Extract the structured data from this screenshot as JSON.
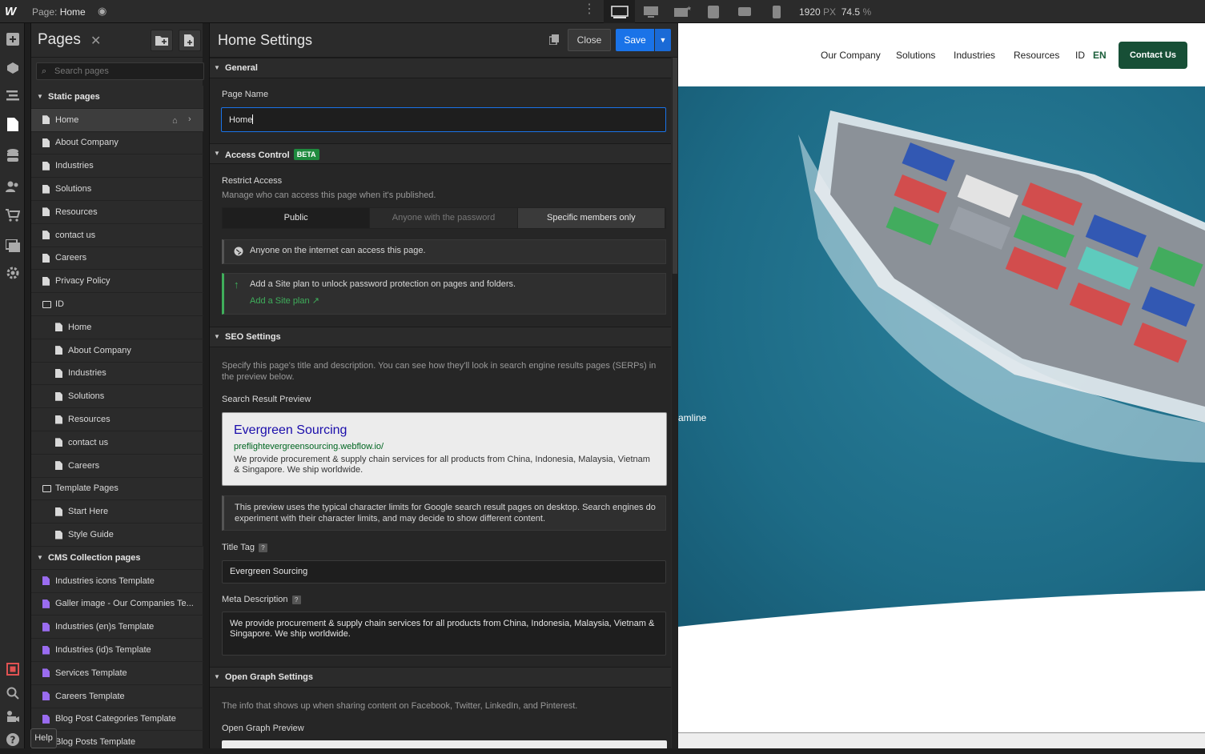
{
  "topbar": {
    "page_prefix": "Page:",
    "page_name": "Home",
    "width_value": "1920",
    "width_unit": "PX",
    "zoom_value": "74.5",
    "zoom_unit": "%"
  },
  "pages_panel": {
    "title": "Pages",
    "search_placeholder": "Search pages",
    "static_header": "Static pages",
    "static_pages": [
      "Home",
      "About Company",
      "Industries",
      "Solutions",
      "Resources",
      "contact us",
      "Careers",
      "Privacy Policy"
    ],
    "id_folder": "ID",
    "id_pages": [
      "Home",
      "About Company",
      "Industries",
      "Solutions",
      "Resources",
      "contact us",
      "Careers"
    ],
    "template_folder": "Template Pages",
    "template_pages": [
      "Start Here",
      "Style Guide"
    ],
    "cms_header": "CMS Collection pages",
    "cms_pages": [
      "Industries icons Template",
      "Galler image - Our Companies Te...",
      "Industries (en)s Template",
      "Industries (id)s Template",
      "Services Template",
      "Careers Template",
      "Blog Post Categories Template",
      "Blog Posts Template"
    ]
  },
  "settings": {
    "title": "Home Settings",
    "close_label": "Close",
    "save_label": "Save",
    "general": {
      "header": "General",
      "page_name_label": "Page Name",
      "page_name_value": "Home"
    },
    "access": {
      "header": "Access Control",
      "badge": "BETA",
      "restrict_label": "Restrict Access",
      "restrict_desc": "Manage who can access this page when it's published.",
      "options": [
        "Public",
        "Anyone with the password",
        "Specific members only"
      ],
      "public_note": "Anyone on the internet can access this page.",
      "upgrade_note": "Add a Site plan to unlock password protection on pages and folders.",
      "upgrade_link": "Add a Site plan"
    },
    "seo": {
      "header": "SEO Settings",
      "desc": "Specify this page's title and description. You can see how they'll look in search engine results pages (SERPs) in the preview below.",
      "preview_label": "Search Result Preview",
      "preview_title": "Evergreen Sourcing",
      "preview_url": "preflightevergreensourcing.webflow.io/",
      "preview_desc": "We provide procurement & supply chain services for all products from China, Indonesia, Malaysia, Vietnam & Singapore. We ship worldwide.",
      "preview_note": "This preview uses the typical character limits for Google search result pages on desktop. Search engines do experiment with their character limits, and may decide to show different content.",
      "title_tag_label": "Title Tag",
      "title_tag_value": "Evergreen Sourcing",
      "help_q": "?",
      "meta_label": "Meta Description",
      "meta_value": "We provide procurement & supply chain services for all products from China, Indonesia, Malaysia, Vietnam & Singapore. We ship worldwide."
    },
    "og": {
      "header": "Open Graph Settings",
      "desc": "The info that shows up when sharing content on Facebook, Twitter, LinkedIn, and Pinterest.",
      "preview_label": "Open Graph Preview"
    }
  },
  "site": {
    "nav": [
      "Our Company",
      "Solutions",
      "Industries",
      "Resources",
      "ID",
      "EN"
    ],
    "cta": "Contact Us",
    "hero_fragment": "amline"
  },
  "help": "Help",
  "colors": {
    "accent": "#1a73e8",
    "brand": "#174f36",
    "cms": "#9a6cf0"
  }
}
